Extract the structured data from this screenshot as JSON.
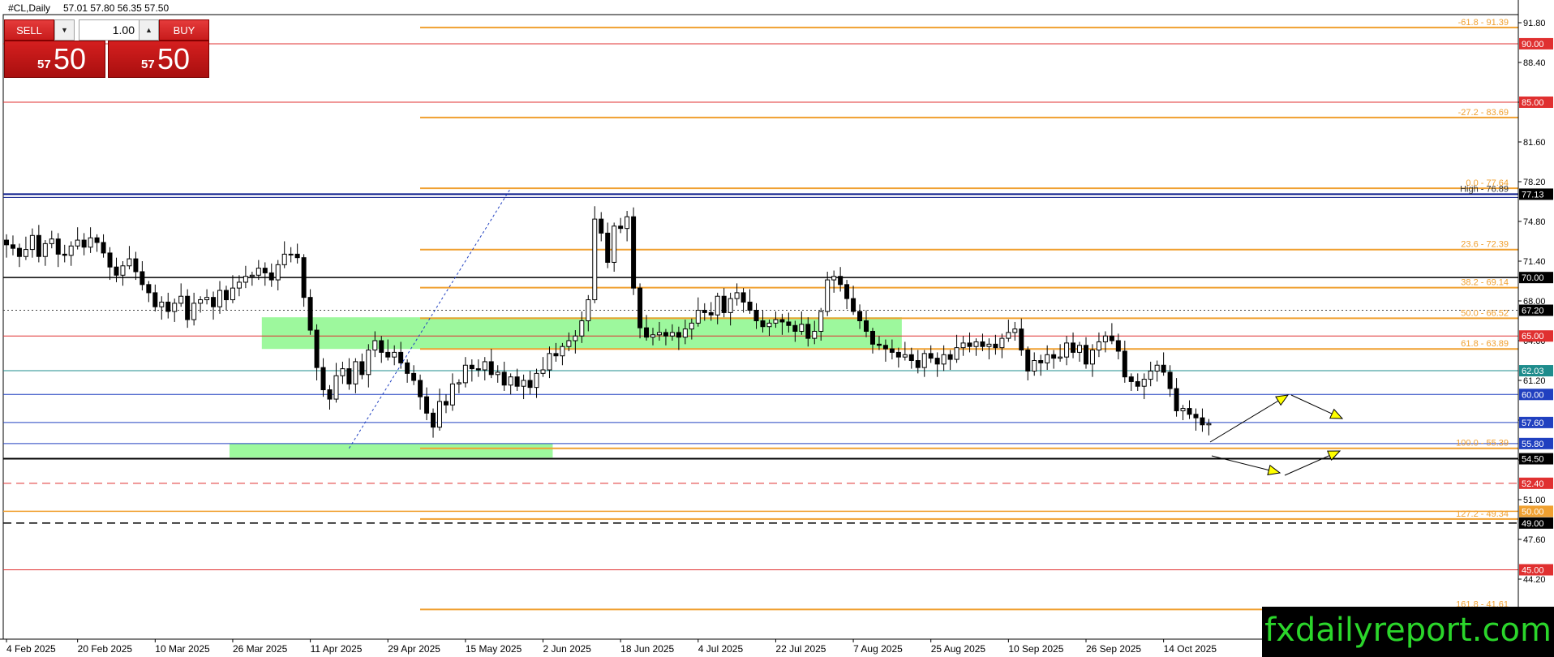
{
  "header": {
    "symbol": "#CL,Daily",
    "ohlc": "57.01 57.80 56.35 57.50"
  },
  "trade_panel": {
    "sell_label": "SELL",
    "buy_label": "BUY",
    "lot": "1.00",
    "sell_price_small": "57",
    "sell_price_big": "50",
    "buy_price_small": "57",
    "buy_price_big": "50",
    "down_arrow": "▼",
    "up_arrow": "▲"
  },
  "brand": "fxdailyreport.com",
  "colors": {
    "bull_body": "#ffffff",
    "bear_body": "#000000",
    "candle_outline": "#000000",
    "fib": "#f0a030",
    "red_level": "#e03030",
    "blue_level": "#2040c0",
    "teal_level": "#1e8c8c",
    "zone": "#98f898",
    "arrow_fill": "#ffff00"
  },
  "chart_data": {
    "type": "candlestick",
    "title": "#CL,Daily",
    "ylim": [
      41.8,
      93.7
    ],
    "y_ticks": [
      "91.80",
      "88.40",
      "85.00",
      "81.60",
      "78.20",
      "74.80",
      "71.40",
      "68.00",
      "64.60",
      "61.20",
      "57.80",
      "54.40",
      "51.00",
      "47.60",
      "44.20"
    ],
    "x_labels": [
      "4 Feb 2025",
      "20 Feb 2025",
      "10 Mar 2025",
      "26 Mar 2025",
      "11 Apr 2025",
      "29 Apr 2025",
      "15 May 2025",
      "2 Jun 2025",
      "18 Jun 2025",
      "4 Jul 2025",
      "22 Jul 2025",
      "7 Aug 2025",
      "25 Aug 2025",
      "10 Sep 2025",
      "26 Sep 2025",
      "14 Oct 2025"
    ],
    "x_label_index": [
      0,
      11,
      23,
      35,
      47,
      59,
      71,
      83,
      95,
      107,
      119,
      131,
      143,
      155,
      167,
      179
    ],
    "n_bars": 185,
    "closes": [
      72.8,
      72.5,
      71.8,
      72.4,
      73.6,
      71.8,
      72.9,
      73.3,
      72.0,
      71.9,
      72.7,
      73.2,
      72.6,
      73.4,
      73.0,
      72.1,
      70.9,
      70.2,
      71.0,
      71.6,
      70.5,
      69.4,
      68.7,
      67.5,
      67.9,
      67.1,
      67.8,
      68.4,
      66.4,
      67.8,
      68.1,
      68.3,
      67.5,
      68.9,
      68.1,
      69.1,
      69.6,
      70.1,
      70.2,
      70.8,
      70.4,
      69.8,
      71.1,
      72.0,
      72.0,
      71.7,
      68.3,
      65.5,
      62.3,
      60.4,
      59.6,
      61.6,
      62.2,
      60.9,
      62.8,
      61.7,
      63.8,
      64.6,
      63.6,
      63.2,
      63.6,
      62.7,
      61.8,
      61.2,
      59.8,
      58.4,
      57.2,
      59.4,
      59.1,
      60.9,
      61.0,
      62.5,
      62.2,
      62.1,
      62.8,
      61.7,
      61.9,
      60.8,
      61.5,
      60.7,
      61.2,
      60.6,
      61.8,
      62.1,
      63.5,
      63.3,
      64.1,
      64.6,
      65.0,
      66.3,
      68.1,
      75.0,
      73.8,
      71.3,
      74.4,
      74.2,
      75.2,
      69.1,
      65.7,
      64.9,
      65.1,
      65.3,
      65.0,
      65.3,
      64.9,
      65.6,
      66.1,
      67.2,
      67.0,
      66.8,
      68.4,
      67.0,
      68.2,
      68.7,
      67.9,
      67.2,
      66.3,
      65.8,
      66.1,
      66.4,
      66.2,
      65.9,
      65.4,
      66.0,
      64.8,
      65.4,
      67.1,
      69.8,
      70.1,
      69.4,
      68.2,
      67.1,
      66.3,
      65.4,
      64.3,
      64.2,
      63.9,
      63.6,
      63.2,
      63.4,
      62.9,
      62.3,
      63.5,
      63.1,
      62.6,
      63.4,
      63.0,
      64.0,
      64.4,
      64.1,
      64.5,
      64.1,
      64.3,
      64.0,
      64.8,
      65.3,
      65.6,
      63.8,
      62.0,
      62.9,
      62.7,
      63.4,
      63.1,
      63.2,
      64.4,
      63.6,
      64.2,
      62.6,
      63.8,
      64.5,
      65.0,
      64.6,
      63.7,
      61.5,
      61.1,
      60.7,
      61.3,
      62.0,
      62.5,
      61.9,
      60.5,
      58.6,
      58.8,
      58.3,
      58.0,
      57.4,
      57.5
    ],
    "h_levels": [
      {
        "value": 90.0,
        "label": "90.00",
        "style": "red"
      },
      {
        "value": 85.0,
        "label": "85.00",
        "style": "red"
      },
      {
        "value": 77.13,
        "label": "77.13",
        "style": "navy"
      },
      {
        "value": 70.0,
        "label": "70.00",
        "style": "black"
      },
      {
        "value": 67.2,
        "label": "67.20",
        "style": "dotted"
      },
      {
        "value": 65.0,
        "label": "65.00",
        "style": "red"
      },
      {
        "value": 62.03,
        "label": "62.03",
        "style": "teal"
      },
      {
        "value": 60.0,
        "label": "60.00",
        "style": "blue"
      },
      {
        "value": 57.6,
        "label": "57.60",
        "style": "blue"
      },
      {
        "value": 55.8,
        "label": "55.80",
        "style": "blue"
      },
      {
        "value": 54.5,
        "label": "54.50",
        "style": "black-thick"
      },
      {
        "value": 52.4,
        "label": "52.40",
        "style": "red-dash"
      },
      {
        "value": 50.0,
        "label": "50.00",
        "style": "orange"
      },
      {
        "value": 49.0,
        "label": "49.00",
        "style": "black-dash"
      },
      {
        "value": 45.0,
        "label": "45.00",
        "style": "red"
      }
    ],
    "fib_levels": [
      {
        "value": 91.39,
        "label": "-61.8 - 91.39"
      },
      {
        "value": 83.69,
        "label": "-27.2 - 83.69"
      },
      {
        "value": 77.64,
        "label": "0.0 - 77.64"
      },
      {
        "value": 72.39,
        "label": "23.6 - 72.39"
      },
      {
        "value": 69.14,
        "label": "38.2 - 69.14"
      },
      {
        "value": 66.52,
        "label": "50.0 - 66.52"
      },
      {
        "value": 63.89,
        "label": "61.8 - 63.89"
      },
      {
        "value": 55.39,
        "label": "100.0 - 55.39"
      },
      {
        "value": 49.34,
        "label": "127.2 - 49.34"
      },
      {
        "value": 41.61,
        "label": "161.8 - 41.61"
      }
    ],
    "high_label": "High - 76.89",
    "zones": [
      {
        "from_index": 35,
        "to_index": 84,
        "low": 54.6,
        "high": 55.8
      },
      {
        "from_index": 40,
        "to_index": 138,
        "low": 63.89,
        "high": 66.6
      }
    ]
  }
}
